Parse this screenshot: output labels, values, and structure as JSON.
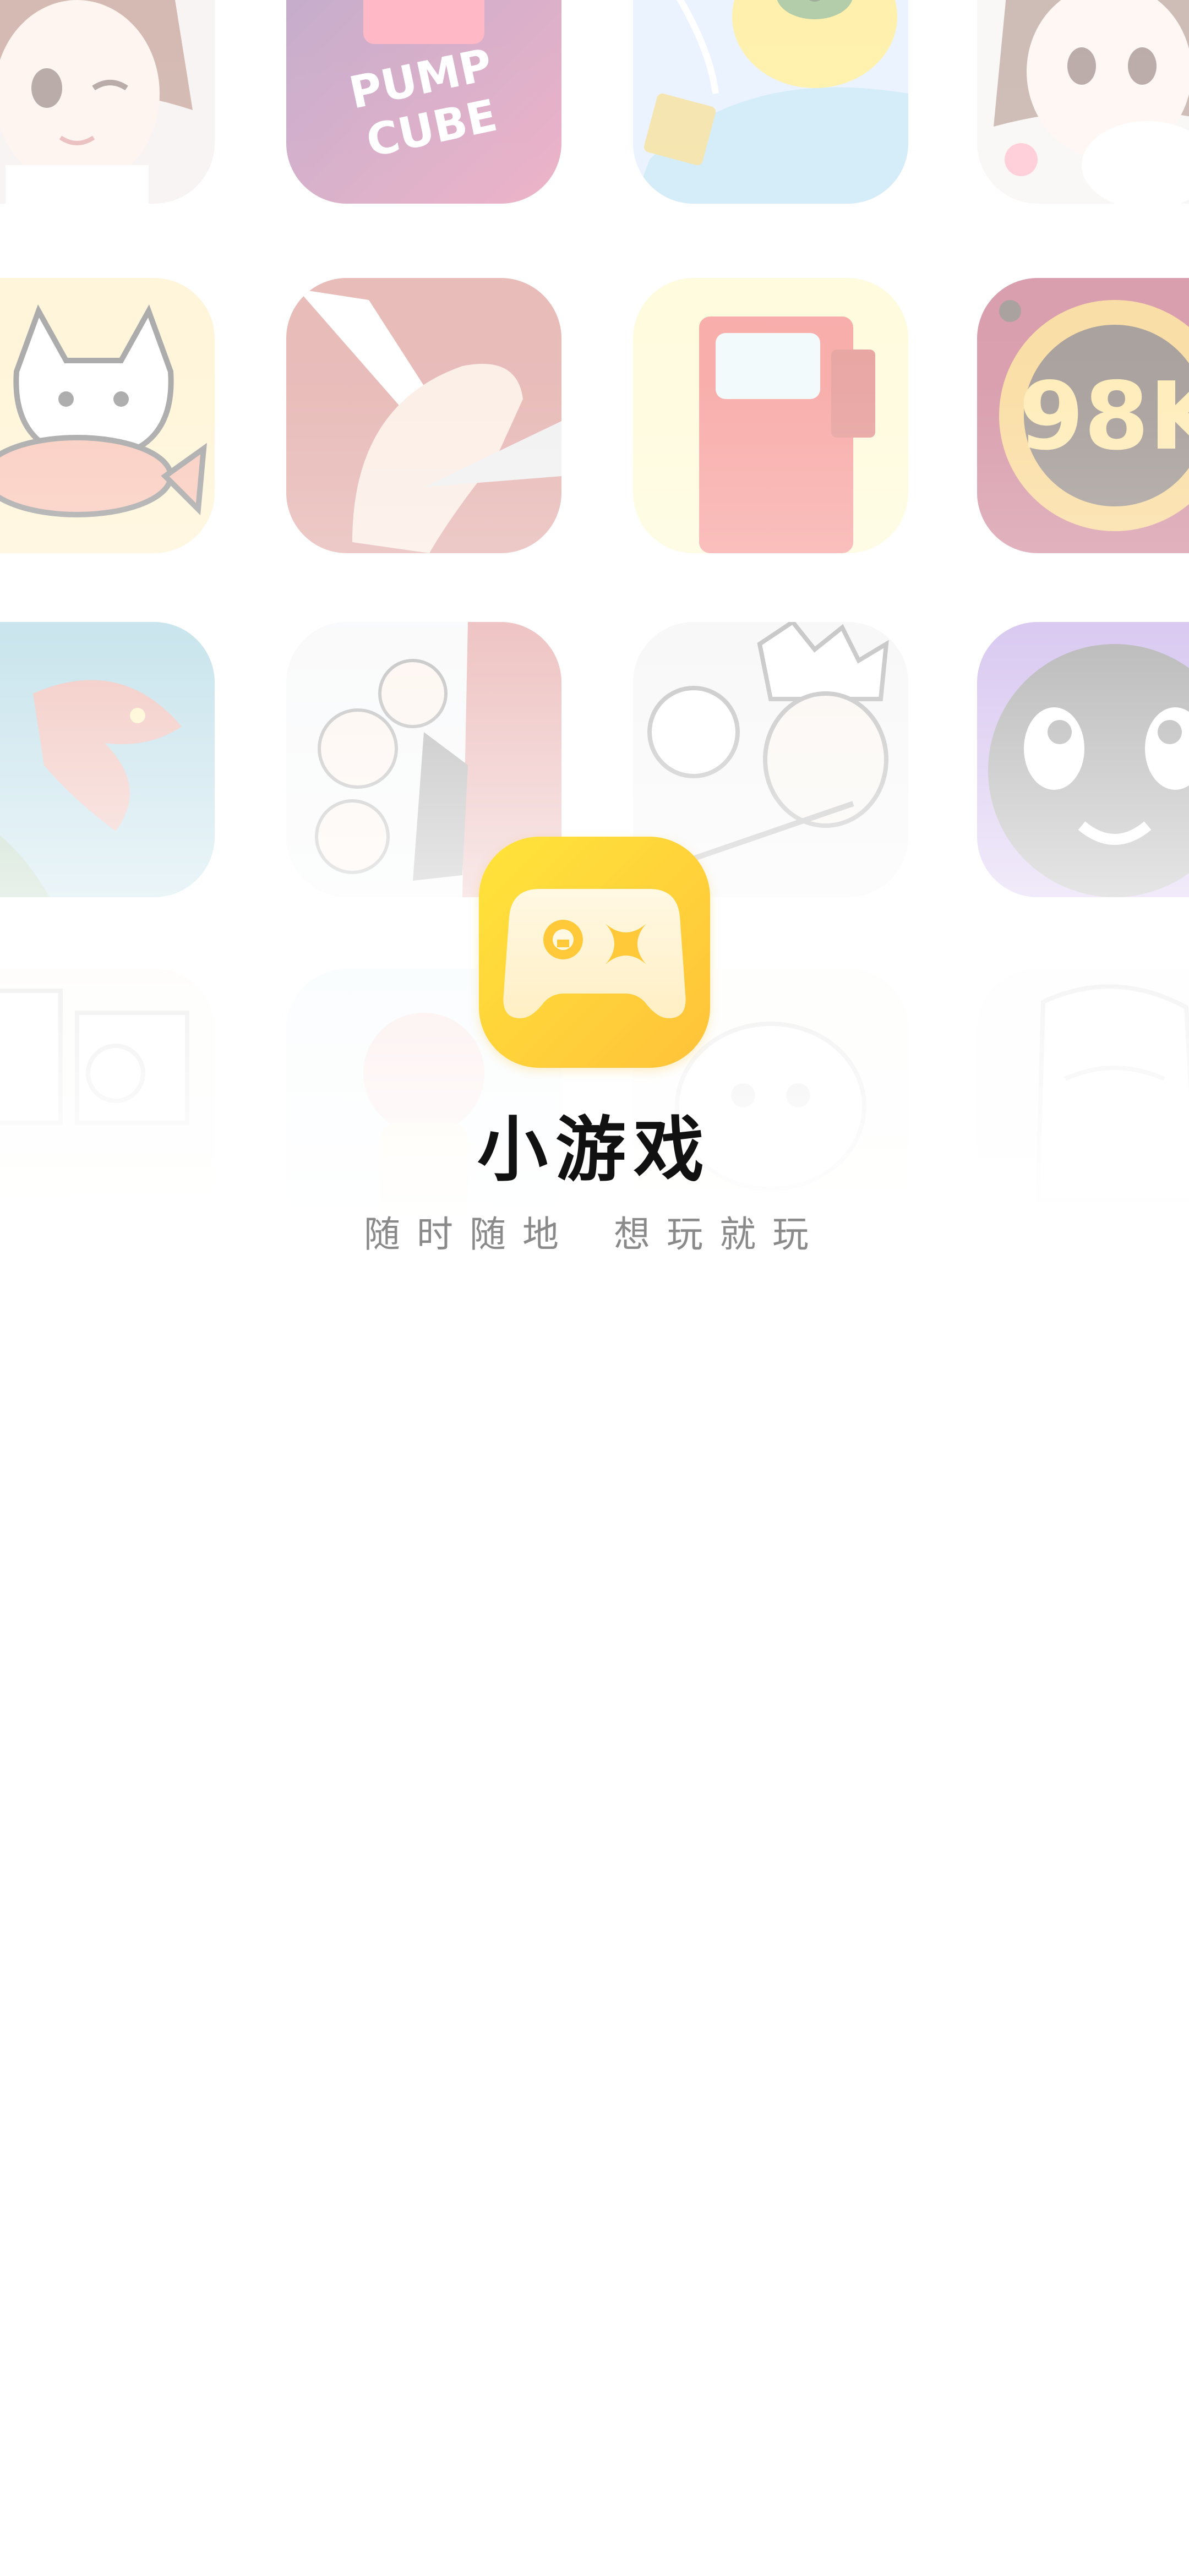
{
  "app": {
    "title": "小游戏",
    "slogan_part1": "随时随地",
    "slogan_part2": "想玩就玩",
    "logo_icon": "gamepad-icon",
    "accent_color": "#FFCB2E"
  },
  "background_tiles": {
    "row1": [
      {
        "icon": "anime-girl-game-icon"
      },
      {
        "icon": "pump-cube-game-icon",
        "text_line1": "PUMP",
        "text_line2": "CUBE"
      },
      {
        "icon": "yellow-duck-game-icon"
      },
      {
        "icon": "anime-girl-with-cat-game-icon"
      }
    ],
    "row2": [
      {
        "icon": "cat-and-fish-game-icon"
      },
      {
        "icon": "hands-and-knife-game-icon"
      },
      {
        "icon": "red-block-character-game-icon"
      },
      {
        "icon": "coin-98k-game-icon",
        "text": "98K"
      }
    ],
    "row3": [
      {
        "icon": "dragon-game-icon"
      },
      {
        "icon": "family-cartoon-game-icon"
      },
      {
        "icon": "king-cartoon-game-icon"
      },
      {
        "icon": "black-ghost-face-game-icon"
      }
    ],
    "row4": [
      {
        "icon": "comic-game-icon"
      },
      {
        "icon": "red-figure-game-icon"
      },
      {
        "icon": "cartoon-game-icon"
      },
      {
        "icon": "sketch-game-icon"
      }
    ]
  }
}
